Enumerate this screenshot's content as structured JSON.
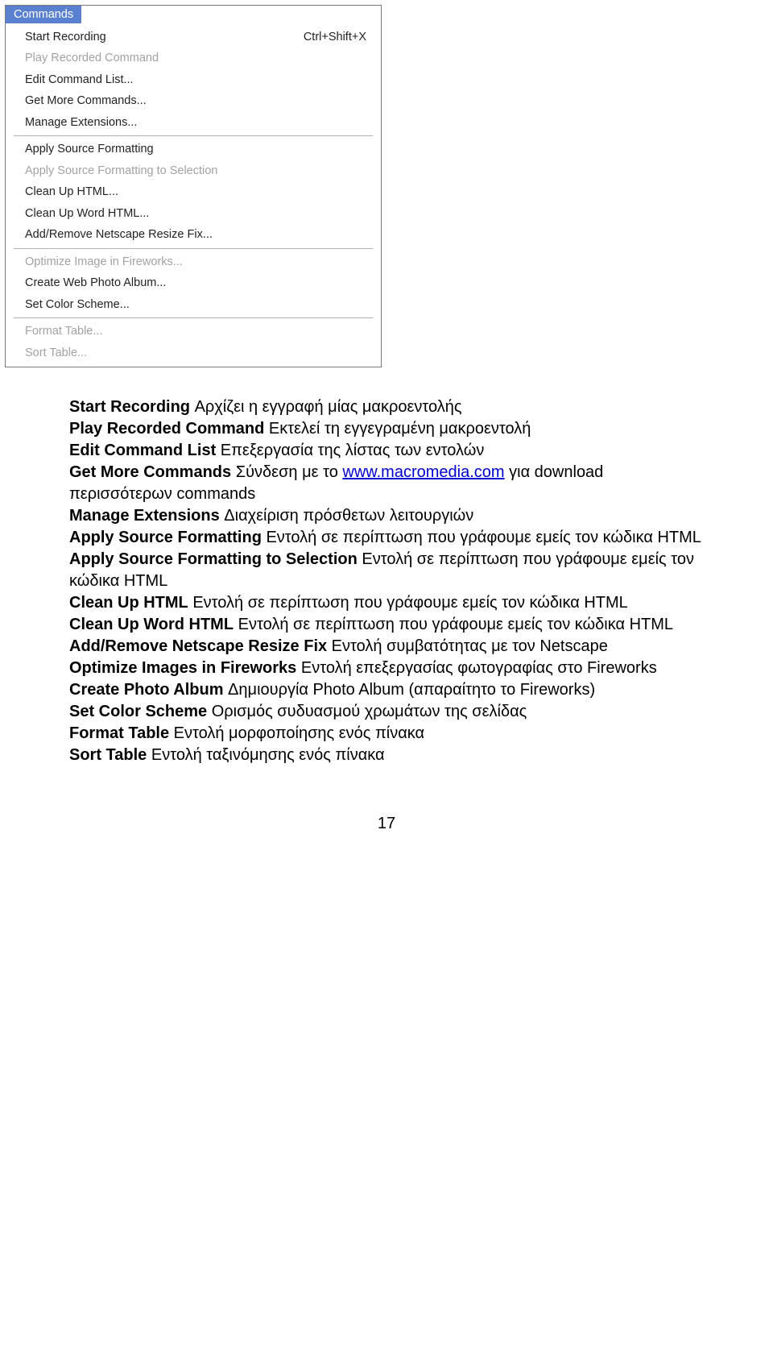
{
  "menu": {
    "title": "Commands",
    "groups": [
      [
        {
          "label": "Start Recording",
          "shortcut": "Ctrl+Shift+X",
          "disabled": false
        },
        {
          "label": "Play Recorded Command",
          "shortcut": "",
          "disabled": true
        },
        {
          "label": "Edit Command List...",
          "shortcut": "",
          "disabled": false
        },
        {
          "label": "Get More Commands...",
          "shortcut": "",
          "disabled": false
        },
        {
          "label": "Manage Extensions...",
          "shortcut": "",
          "disabled": false
        }
      ],
      [
        {
          "label": "Apply Source Formatting",
          "shortcut": "",
          "disabled": false
        },
        {
          "label": "Apply Source Formatting to Selection",
          "shortcut": "",
          "disabled": true
        },
        {
          "label": "Clean Up HTML...",
          "shortcut": "",
          "disabled": false
        },
        {
          "label": "Clean Up Word HTML...",
          "shortcut": "",
          "disabled": false
        },
        {
          "label": "Add/Remove Netscape Resize Fix...",
          "shortcut": "",
          "disabled": false
        }
      ],
      [
        {
          "label": "Optimize Image in Fireworks...",
          "shortcut": "",
          "disabled": true
        },
        {
          "label": "Create Web Photo Album...",
          "shortcut": "",
          "disabled": false
        },
        {
          "label": "Set Color Scheme...",
          "shortcut": "",
          "disabled": false
        }
      ],
      [
        {
          "label": "Format Table...",
          "shortcut": "",
          "disabled": true
        },
        {
          "label": "Sort Table...",
          "shortcut": "",
          "disabled": true
        }
      ]
    ]
  },
  "doc": {
    "items": [
      {
        "term": "Start Recording",
        "desc_before": " Αρχίζει η εγγραφή μίας μακροεντολής"
      },
      {
        "term": "Play Recorded Command",
        "desc_before": " Εκτελεί τη εγγεγραμένη μακροεντολή"
      },
      {
        "term": "Edit Command List",
        "desc_before": " Επεξεργασία της λίστας των εντολών"
      },
      {
        "term": "Get More Commands",
        "desc_before": " Σύνδεση με το ",
        "link_text": "www.macromedia.com",
        "desc_after": " για download περισσότερων commands"
      },
      {
        "term": "Manage Extensions",
        "desc_before": " Διαχείριση πρόσθετων λειτουργιών"
      },
      {
        "term": "Apply Source Formatting",
        "desc_before": " Εντολή σε περίπτωση που γράφουμε εμείς τον κώδικα HTML"
      },
      {
        "term": "Apply Source Formatting to Selection",
        "desc_before": " Εντολή σε περίπτωση που γράφουμε εμείς τον κώδικα HTML"
      },
      {
        "term": "Clean Up HTML",
        "desc_before": " Εντολή σε περίπτωση που γράφουμε εμείς τον κώδικα HTML"
      },
      {
        "term": "Clean Up Word HTML",
        "desc_before": " Εντολή σε περίπτωση που γράφουμε εμείς τον κώδικα HTML"
      },
      {
        "term": "Add/Remove Netscape Resize Fix",
        "desc_before": " Εντολή συμβατότητας με τον Netscape"
      },
      {
        "term": "Optimize Images in Fireworks",
        "desc_before": " Εντολή επεξεργασίας φωτογραφίας στο Fireworks"
      },
      {
        "term": "Create Photo Album",
        "desc_before": " Δημιουργία Photo Album (απαραίτητο το Fireworks)"
      },
      {
        "term": "Set Color Scheme",
        "desc_before": " Ορισμός συδυασμού χρωμάτων της σελίδας"
      },
      {
        "term": "Format Table",
        "desc_before": " Εντολή μορφοποίησης ενός πίνακα"
      },
      {
        "term": "Sort Table",
        "desc_before": " Εντολή ταξινόμησης ενός πίνακα"
      }
    ]
  },
  "page_number": "17"
}
